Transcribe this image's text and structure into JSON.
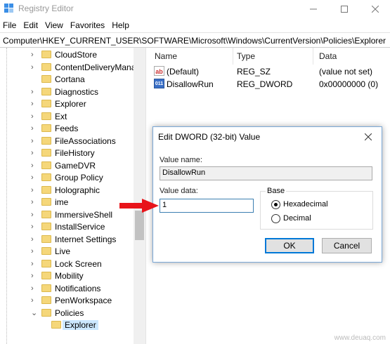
{
  "window": {
    "title": "Registry Editor",
    "controls": [
      "minimize",
      "maximize",
      "close"
    ]
  },
  "menu": [
    "File",
    "Edit",
    "View",
    "Favorites",
    "Help"
  ],
  "address": "Computer\\HKEY_CURRENT_USER\\SOFTWARE\\Microsoft\\Windows\\CurrentVersion\\Policies\\Explorer",
  "tree": [
    {
      "label": "CloudStore",
      "expander": "›"
    },
    {
      "label": "ContentDeliveryMana",
      "expander": "›"
    },
    {
      "label": "Cortana",
      "expander": ""
    },
    {
      "label": "Diagnostics",
      "expander": "›"
    },
    {
      "label": "Explorer",
      "expander": "›"
    },
    {
      "label": "Ext",
      "expander": "›"
    },
    {
      "label": "Feeds",
      "expander": "›"
    },
    {
      "label": "FileAssociations",
      "expander": "›"
    },
    {
      "label": "FileHistory",
      "expander": "›"
    },
    {
      "label": "GameDVR",
      "expander": "›"
    },
    {
      "label": "Group Policy",
      "expander": "›"
    },
    {
      "label": "Holographic",
      "expander": "›"
    },
    {
      "label": "ime",
      "expander": "›"
    },
    {
      "label": "ImmersiveShell",
      "expander": "›"
    },
    {
      "label": "InstallService",
      "expander": "›"
    },
    {
      "label": "Internet Settings",
      "expander": "›"
    },
    {
      "label": "Live",
      "expander": "›"
    },
    {
      "label": "Lock Screen",
      "expander": "›"
    },
    {
      "label": "Mobility",
      "expander": "›"
    },
    {
      "label": "Notifications",
      "expander": "›"
    },
    {
      "label": "PenWorkspace",
      "expander": "›"
    },
    {
      "label": "Policies",
      "expander": "⌄"
    },
    {
      "label": "Explorer",
      "expander": "",
      "selected": true,
      "indent": 1
    }
  ],
  "columns": {
    "name": "Name",
    "type": "Type",
    "data": "Data"
  },
  "values": [
    {
      "name": "(Default)",
      "type": "REG_SZ",
      "data": "(value not set)",
      "icon": "string-value-icon",
      "glyph": "ab"
    },
    {
      "name": "DisallowRun",
      "type": "REG_DWORD",
      "data": "0x00000000 (0)",
      "icon": "binary-value-icon",
      "glyph": "011"
    }
  ],
  "dialog": {
    "title": "Edit DWORD (32-bit) Value",
    "value_name_label": "Value name:",
    "value_name": "DisallowRun",
    "value_data_label": "Value data:",
    "value_data": "1",
    "base_label": "Base",
    "base_options": [
      {
        "label": "Hexadecimal",
        "selected": true
      },
      {
        "label": "Decimal",
        "selected": false
      }
    ],
    "ok": "OK",
    "cancel": "Cancel"
  },
  "watermark": "www.deuaq.com",
  "colors": {
    "arrow": "#e8141a",
    "folder": "#f5d77a",
    "selection": "#cce8ff",
    "accent": "#0078d7"
  }
}
